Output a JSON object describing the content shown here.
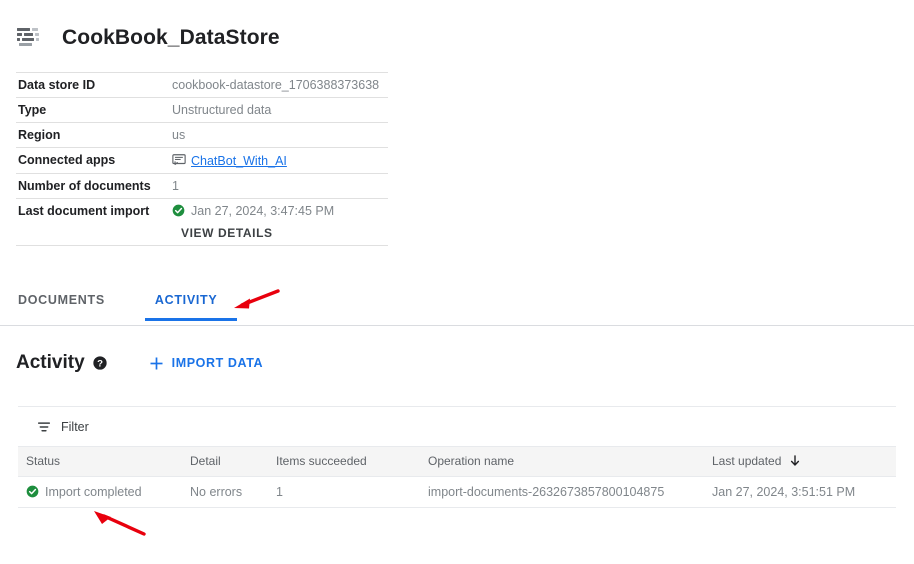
{
  "header": {
    "icon": "datastore-icon",
    "title": "CookBook_DataStore"
  },
  "info": {
    "rows": [
      {
        "label": "Data store ID",
        "value": "cookbook-datastore_1706388373638",
        "kind": "text"
      },
      {
        "label": "Type",
        "value": "Unstructured data",
        "kind": "text"
      },
      {
        "label": "Region",
        "value": "us",
        "kind": "text"
      },
      {
        "label": "Connected apps",
        "value": "ChatBot_With_AI",
        "kind": "link",
        "icon": "chat-app-icon"
      },
      {
        "label": "Number of documents",
        "value": "1",
        "kind": "text"
      },
      {
        "label": "Last document import",
        "value": "Jan 27, 2024, 3:47:45 PM",
        "kind": "status",
        "icon": "check-circle-icon",
        "action": "VIEW DETAILS"
      }
    ]
  },
  "tabs": [
    {
      "label": "DOCUMENTS",
      "active": false
    },
    {
      "label": "ACTIVITY",
      "active": true
    }
  ],
  "activity": {
    "title": "Activity",
    "help_icon": "help-icon",
    "import_label": "IMPORT DATA",
    "plus_icon": "plus-icon"
  },
  "toolbar": {
    "filter_label": "Filter",
    "filter_icon": "filter-icon"
  },
  "table": {
    "columns": [
      "Status",
      "Detail",
      "Items succeeded",
      "Operation name",
      "Last updated"
    ],
    "sorted_column": "Last updated",
    "sort_direction": "descending",
    "rows": [
      {
        "status": "Import completed",
        "status_icon": "check-circle-icon",
        "detail": "No errors",
        "items_succeeded": "1",
        "operation_name": "import-documents-2632673857800104875",
        "last_updated": "Jan 27, 2024, 3:51:51 PM"
      }
    ]
  },
  "annotations": [
    {
      "name": "arrow-pointing-to-activity-tab",
      "color": "#e8000d"
    },
    {
      "name": "arrow-pointing-to-import-completed-row",
      "color": "#e8000d"
    }
  ],
  "colors": {
    "accent_blue": "#1a73e8",
    "success_green": "#1e8e3e",
    "annotation_red": "#e8000d",
    "text_primary": "#202124",
    "text_secondary": "#80868b"
  }
}
